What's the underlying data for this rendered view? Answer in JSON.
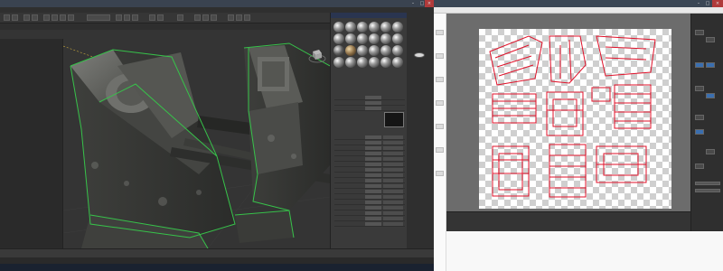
{
  "left_app": {
    "title": "",
    "menus": [
      "",
      "",
      "",
      "",
      "",
      "",
      "",
      "",
      "",
      "",
      "",
      ""
    ],
    "tabs": [
      "",
      "",
      "",
      ""
    ],
    "viewport_label": "",
    "scene_rows": [
      "",
      "",
      "",
      "",
      ""
    ],
    "material_params": [
      "",
      "",
      "",
      "",
      "",
      "",
      "",
      "",
      "",
      "",
      "",
      "",
      "",
      "",
      "",
      "",
      "",
      "",
      "",
      ""
    ]
  },
  "right_app": {
    "title": "",
    "menus": [
      "",
      "",
      "",
      "",
      "",
      "",
      "",
      ""
    ]
  },
  "icons": {
    "view_cube": "view-cube-icon",
    "min": "minimize-icon",
    "max": "maximize-icon",
    "close": "close-icon"
  },
  "colors": {
    "uv_lines": "#e0122a",
    "selection_green": "#37c24a",
    "panel_bg": "#2b2b2b"
  }
}
